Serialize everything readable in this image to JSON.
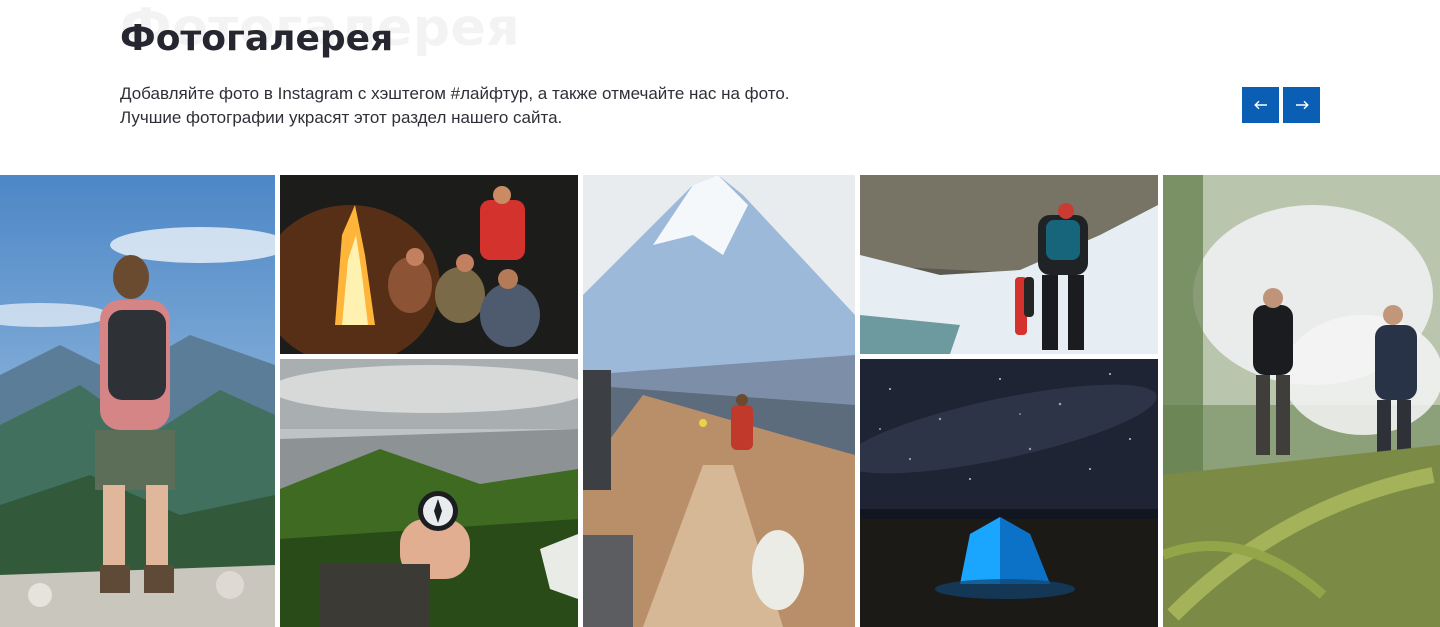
{
  "gallery": {
    "ghost_title": "Фотогалерея",
    "title": "Фотогалерея",
    "description_line1": "Добавляйте фото в Instagram с хэштегом #лайфтур, а также отмечайте нас на фото.",
    "description_line2": "Лучшие фотографии украсят этот раздел нашего сайта.",
    "prev_icon": "arrow-left-icon",
    "next_icon": "arrow-right-icon",
    "accent_color": "#0a5fb4",
    "photos": [
      {
        "subject": "hiker-mountain-view"
      },
      {
        "subject": "campfire-group"
      },
      {
        "subject": "compass-in-hand"
      },
      {
        "subject": "volcano-trail"
      },
      {
        "subject": "glacier-climbers"
      },
      {
        "subject": "tent-under-stars"
      },
      {
        "subject": "smoke-forest-men"
      }
    ]
  }
}
